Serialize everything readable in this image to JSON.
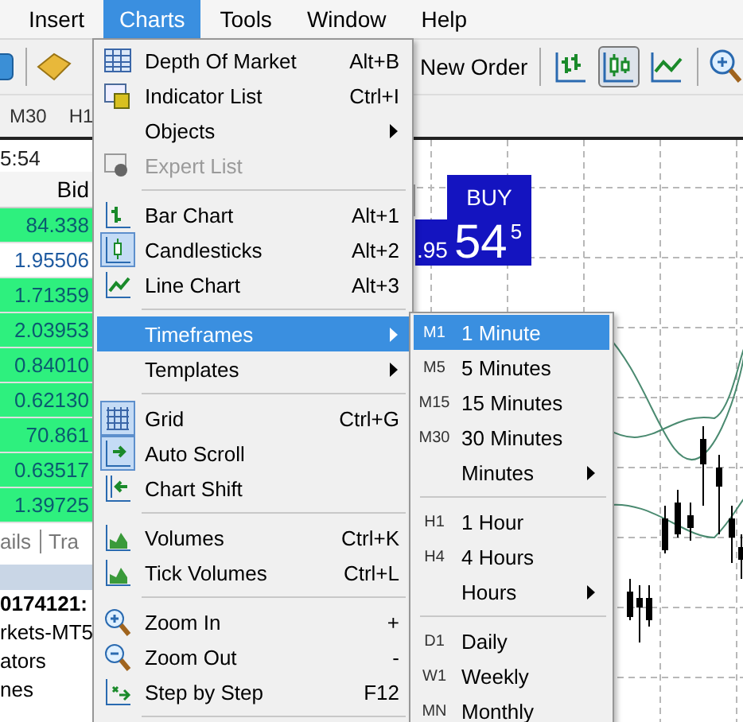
{
  "menu_bar": [
    {
      "label": "Insert",
      "selected": false
    },
    {
      "label": "Charts",
      "selected": true
    },
    {
      "label": "Tools",
      "selected": false
    },
    {
      "label": "Window",
      "selected": false
    },
    {
      "label": "Help",
      "selected": false
    }
  ],
  "toolbar": {
    "new_order": "New Order",
    "chart_buttons": [
      {
        "kind": "bar",
        "selected": false
      },
      {
        "kind": "candles",
        "selected": true
      },
      {
        "kind": "line",
        "selected": false
      }
    ]
  },
  "timeframe_bar": [
    "M30",
    "H1"
  ],
  "market_watch": {
    "time": "5:54",
    "column": "Bid",
    "rows": [
      {
        "bid": "84.338",
        "highlighted": true
      },
      {
        "bid": "1.95506",
        "highlighted": false
      },
      {
        "bid": "1.71359",
        "highlighted": true
      },
      {
        "bid": "2.03953",
        "highlighted": true
      },
      {
        "bid": "0.84010",
        "highlighted": true
      },
      {
        "bid": "0.62130",
        "highlighted": true
      },
      {
        "bid": "70.861",
        "highlighted": true
      },
      {
        "bid": "0.63517",
        "highlighted": true
      },
      {
        "bid": "1.39725",
        "highlighted": true
      }
    ]
  },
  "bottom_tabs": [
    "ails",
    "Tra"
  ],
  "navigator": [
    {
      "text": "0174121:",
      "bold": true
    },
    {
      "text": "rkets-MT5",
      "bold": false
    },
    {
      "text": "ators",
      "bold": false
    },
    {
      "text": "nes",
      "bold": false
    }
  ],
  "trade_panel": {
    "action": "BUY",
    "price_prefix": ".95",
    "price_big": "54",
    "price_sup": "5"
  },
  "charts_menu": [
    {
      "kind": "depth",
      "label": "Depth Of Market",
      "shortcut": "Alt+B",
      "disabled": false,
      "checked": false,
      "submenu": false,
      "selected": false
    },
    {
      "kind": "indicators",
      "label": "Indicator List",
      "shortcut": "Ctrl+I",
      "disabled": false,
      "checked": false,
      "submenu": false,
      "selected": false
    },
    {
      "kind": "plain",
      "label": "Objects",
      "disabled": false,
      "submenu": true,
      "selected": false
    },
    {
      "kind": "expert",
      "label": "Expert List",
      "disabled": true,
      "checked": false,
      "submenu": false,
      "selected": false
    },
    {
      "kind": "separator"
    },
    {
      "kind": "bar",
      "label": "Bar Chart",
      "shortcut": "Alt+1",
      "disabled": false,
      "checked": false,
      "submenu": false,
      "selected": false
    },
    {
      "kind": "candles",
      "label": "Candlesticks",
      "shortcut": "Alt+2",
      "disabled": false,
      "checked": true,
      "submenu": false,
      "selected": false
    },
    {
      "kind": "line",
      "label": "Line Chart",
      "shortcut": "Alt+3",
      "disabled": false,
      "checked": false,
      "submenu": false,
      "selected": false
    },
    {
      "kind": "separator"
    },
    {
      "kind": "plain",
      "label": "Timeframes",
      "disabled": false,
      "submenu": true,
      "selected": true
    },
    {
      "kind": "plain",
      "label": "Templates",
      "disabled": false,
      "submenu": true,
      "selected": false
    },
    {
      "kind": "separator"
    },
    {
      "kind": "grid",
      "label": "Grid",
      "shortcut": "Ctrl+G",
      "disabled": false,
      "checked": true,
      "submenu": false,
      "selected": false
    },
    {
      "kind": "autoscroll",
      "label": "Auto Scroll",
      "disabled": false,
      "checked": true,
      "submenu": false,
      "selected": false
    },
    {
      "kind": "shift",
      "label": "Chart Shift",
      "disabled": false,
      "checked": false,
      "submenu": false,
      "selected": false
    },
    {
      "kind": "separator"
    },
    {
      "kind": "volumes",
      "label": "Volumes",
      "shortcut": "Ctrl+K",
      "disabled": false,
      "checked": false,
      "submenu": false,
      "selected": false
    },
    {
      "kind": "volumes",
      "label": "Tick Volumes",
      "shortcut": "Ctrl+L",
      "disabled": false,
      "checked": false,
      "submenu": false,
      "selected": false
    },
    {
      "kind": "separator"
    },
    {
      "kind": "zoomin",
      "label": "Zoom In",
      "shortcut": "+",
      "disabled": false,
      "checked": false,
      "submenu": false,
      "selected": false
    },
    {
      "kind": "zoomout",
      "label": "Zoom Out",
      "shortcut": "-",
      "disabled": false,
      "checked": false,
      "submenu": false,
      "selected": false
    },
    {
      "kind": "step",
      "label": "Step by Step",
      "shortcut": "F12",
      "disabled": false,
      "checked": false,
      "submenu": false,
      "selected": false
    },
    {
      "kind": "separator"
    }
  ],
  "timeframes_menu": [
    {
      "kind": "item",
      "code": "M1",
      "label": "1 Minute",
      "submenu": false,
      "selected": true
    },
    {
      "kind": "item",
      "code": "M5",
      "label": "5 Minutes",
      "submenu": false,
      "selected": false
    },
    {
      "kind": "item",
      "code": "M15",
      "label": "15 Minutes",
      "submenu": false,
      "selected": false
    },
    {
      "kind": "item",
      "code": "M30",
      "label": "30 Minutes",
      "submenu": false,
      "selected": false
    },
    {
      "kind": "item",
      "label": "Minutes",
      "submenu": true,
      "selected": false
    },
    {
      "kind": "separator"
    },
    {
      "kind": "item",
      "code": "H1",
      "label": "1 Hour",
      "submenu": false,
      "selected": false
    },
    {
      "kind": "item",
      "code": "H4",
      "label": "4 Hours",
      "submenu": false,
      "selected": false
    },
    {
      "kind": "item",
      "label": "Hours",
      "submenu": true,
      "selected": false
    },
    {
      "kind": "separator"
    },
    {
      "kind": "item",
      "code": "D1",
      "label": "Daily",
      "submenu": false,
      "selected": false
    },
    {
      "kind": "item",
      "code": "W1",
      "label": "Weekly",
      "submenu": false,
      "selected": false
    },
    {
      "kind": "item",
      "code": "MN",
      "label": "Monthly",
      "submenu": false,
      "selected": false
    }
  ]
}
